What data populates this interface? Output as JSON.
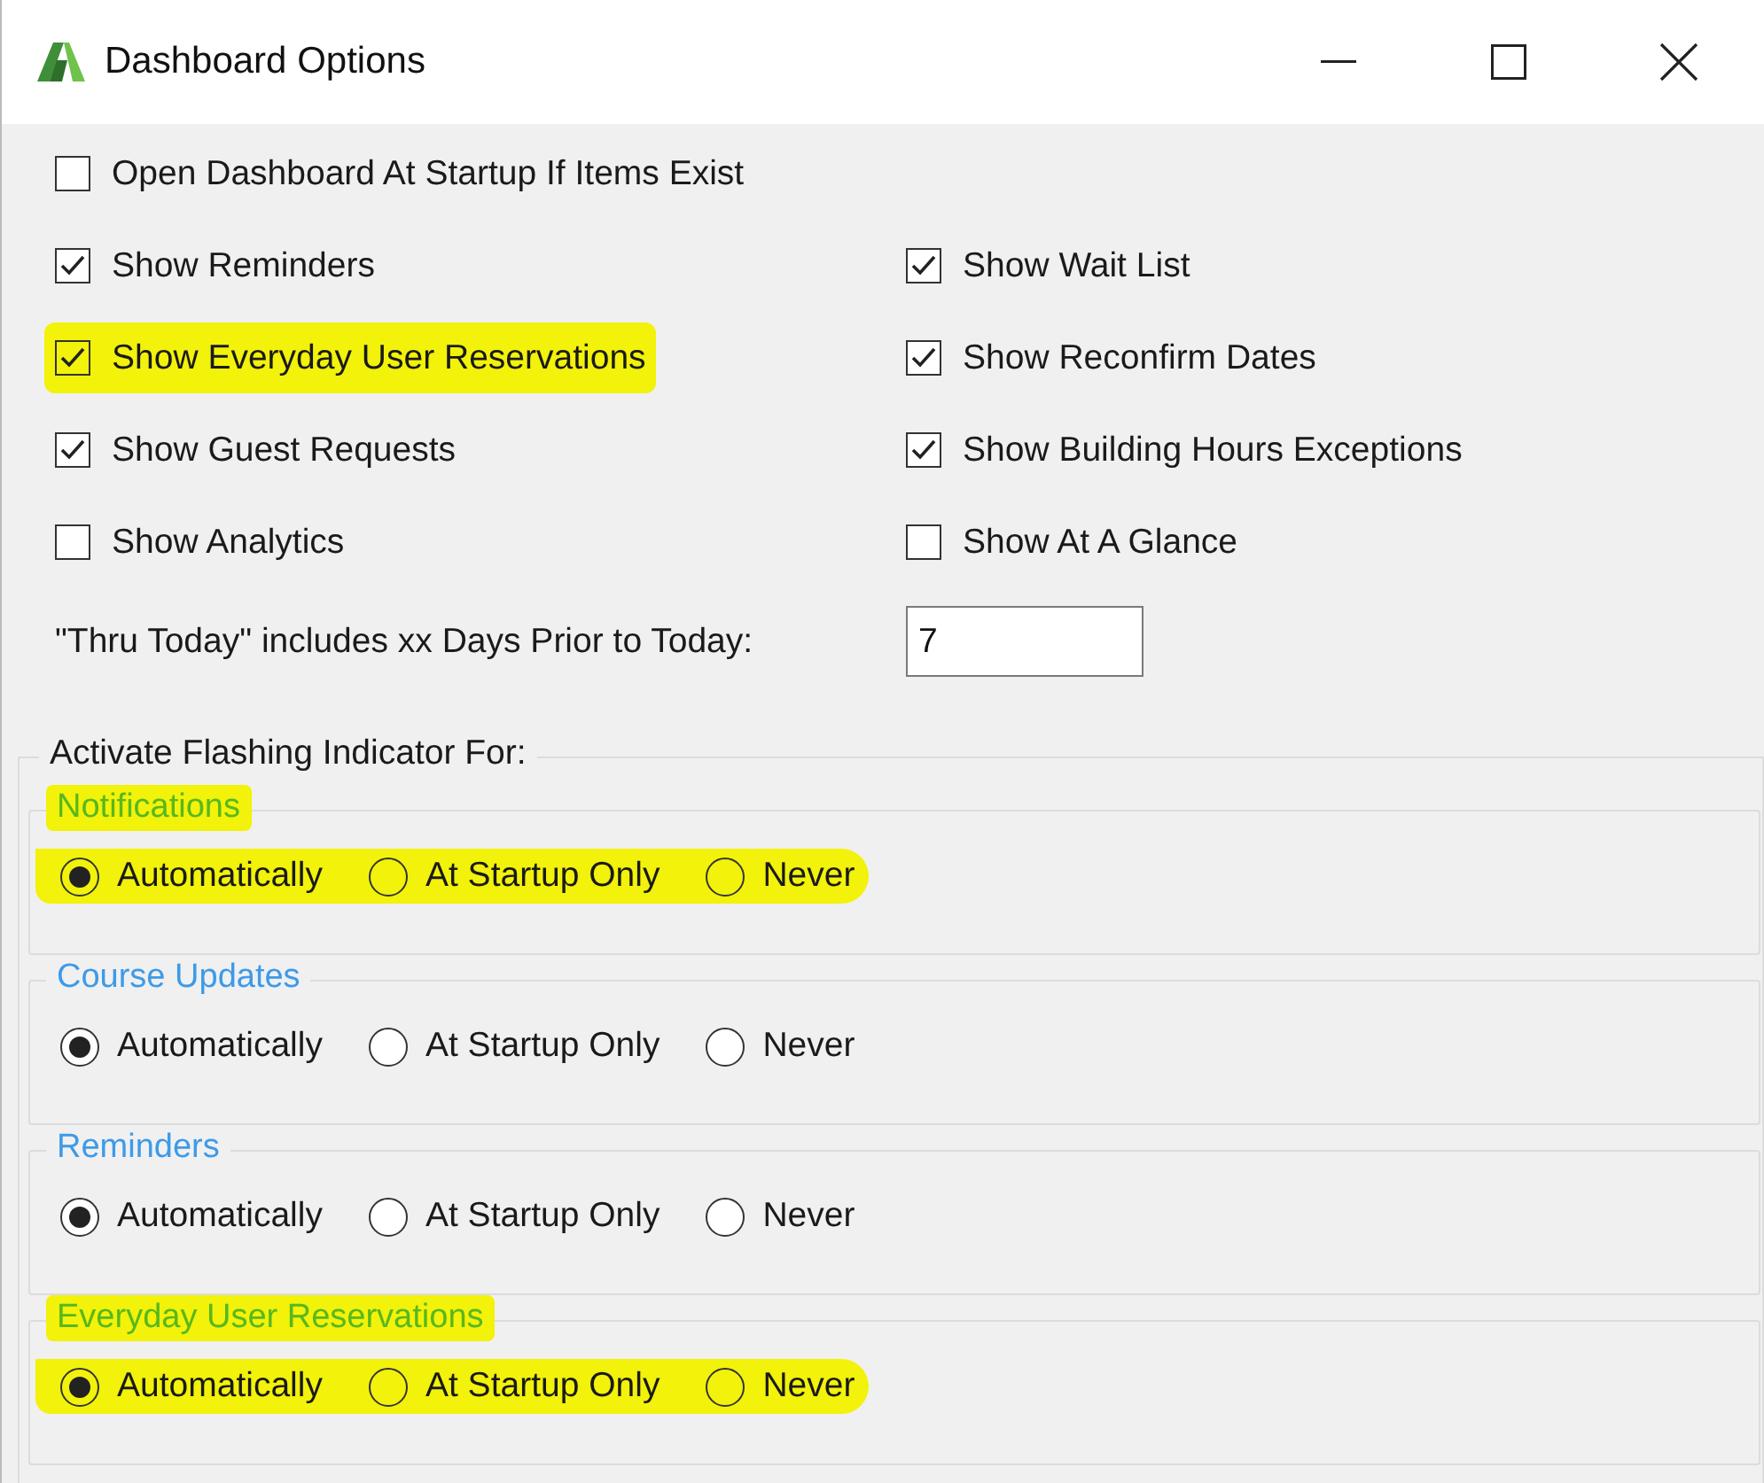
{
  "window": {
    "title": "Dashboard Options"
  },
  "option_rows": [
    [
      {
        "label": "Open Dashboard At Startup If Items Exist",
        "checked": false,
        "highlighted": false
      }
    ],
    [
      {
        "label": "Show Reminders",
        "checked": true,
        "highlighted": false
      },
      {
        "label": "Show Wait List",
        "checked": true,
        "highlighted": false
      }
    ],
    [
      {
        "label": "Show Everyday User Reservations",
        "checked": true,
        "highlighted": true
      },
      {
        "label": "Show Reconfirm Dates",
        "checked": true,
        "highlighted": false
      }
    ],
    [
      {
        "label": "Show Guest Requests",
        "checked": true,
        "highlighted": false
      },
      {
        "label": "Show Building Hours Exceptions",
        "checked": true,
        "highlighted": false
      }
    ],
    [
      {
        "label": "Show Analytics",
        "checked": false,
        "highlighted": false
      },
      {
        "label": "Show At A Glance",
        "checked": false,
        "highlighted": false
      }
    ]
  ],
  "days_field": {
    "label": "\"Thru Today\" includes xx Days Prior to Today:",
    "value": "7"
  },
  "flashing": {
    "title": "Activate Flashing Indicator For:",
    "groups": [
      {
        "title": "Notifications",
        "highlighted": true,
        "options": [
          {
            "label": "Automatically",
            "selected": true
          },
          {
            "label": "At Startup Only",
            "selected": false
          },
          {
            "label": "Never",
            "selected": false
          }
        ]
      },
      {
        "title": "Course Updates",
        "highlighted": false,
        "options": [
          {
            "label": "Automatically",
            "selected": true
          },
          {
            "label": "At Startup Only",
            "selected": false
          },
          {
            "label": "Never",
            "selected": false
          }
        ]
      },
      {
        "title": "Reminders",
        "highlighted": false,
        "options": [
          {
            "label": "Automatically",
            "selected": true
          },
          {
            "label": "At Startup Only",
            "selected": false
          },
          {
            "label": "Never",
            "selected": false
          }
        ]
      },
      {
        "title": "Everyday User Reservations",
        "highlighted": true,
        "options": [
          {
            "label": "Automatically",
            "selected": true
          },
          {
            "label": "At Startup Only",
            "selected": false
          },
          {
            "label": "Never",
            "selected": false
          }
        ]
      }
    ]
  }
}
